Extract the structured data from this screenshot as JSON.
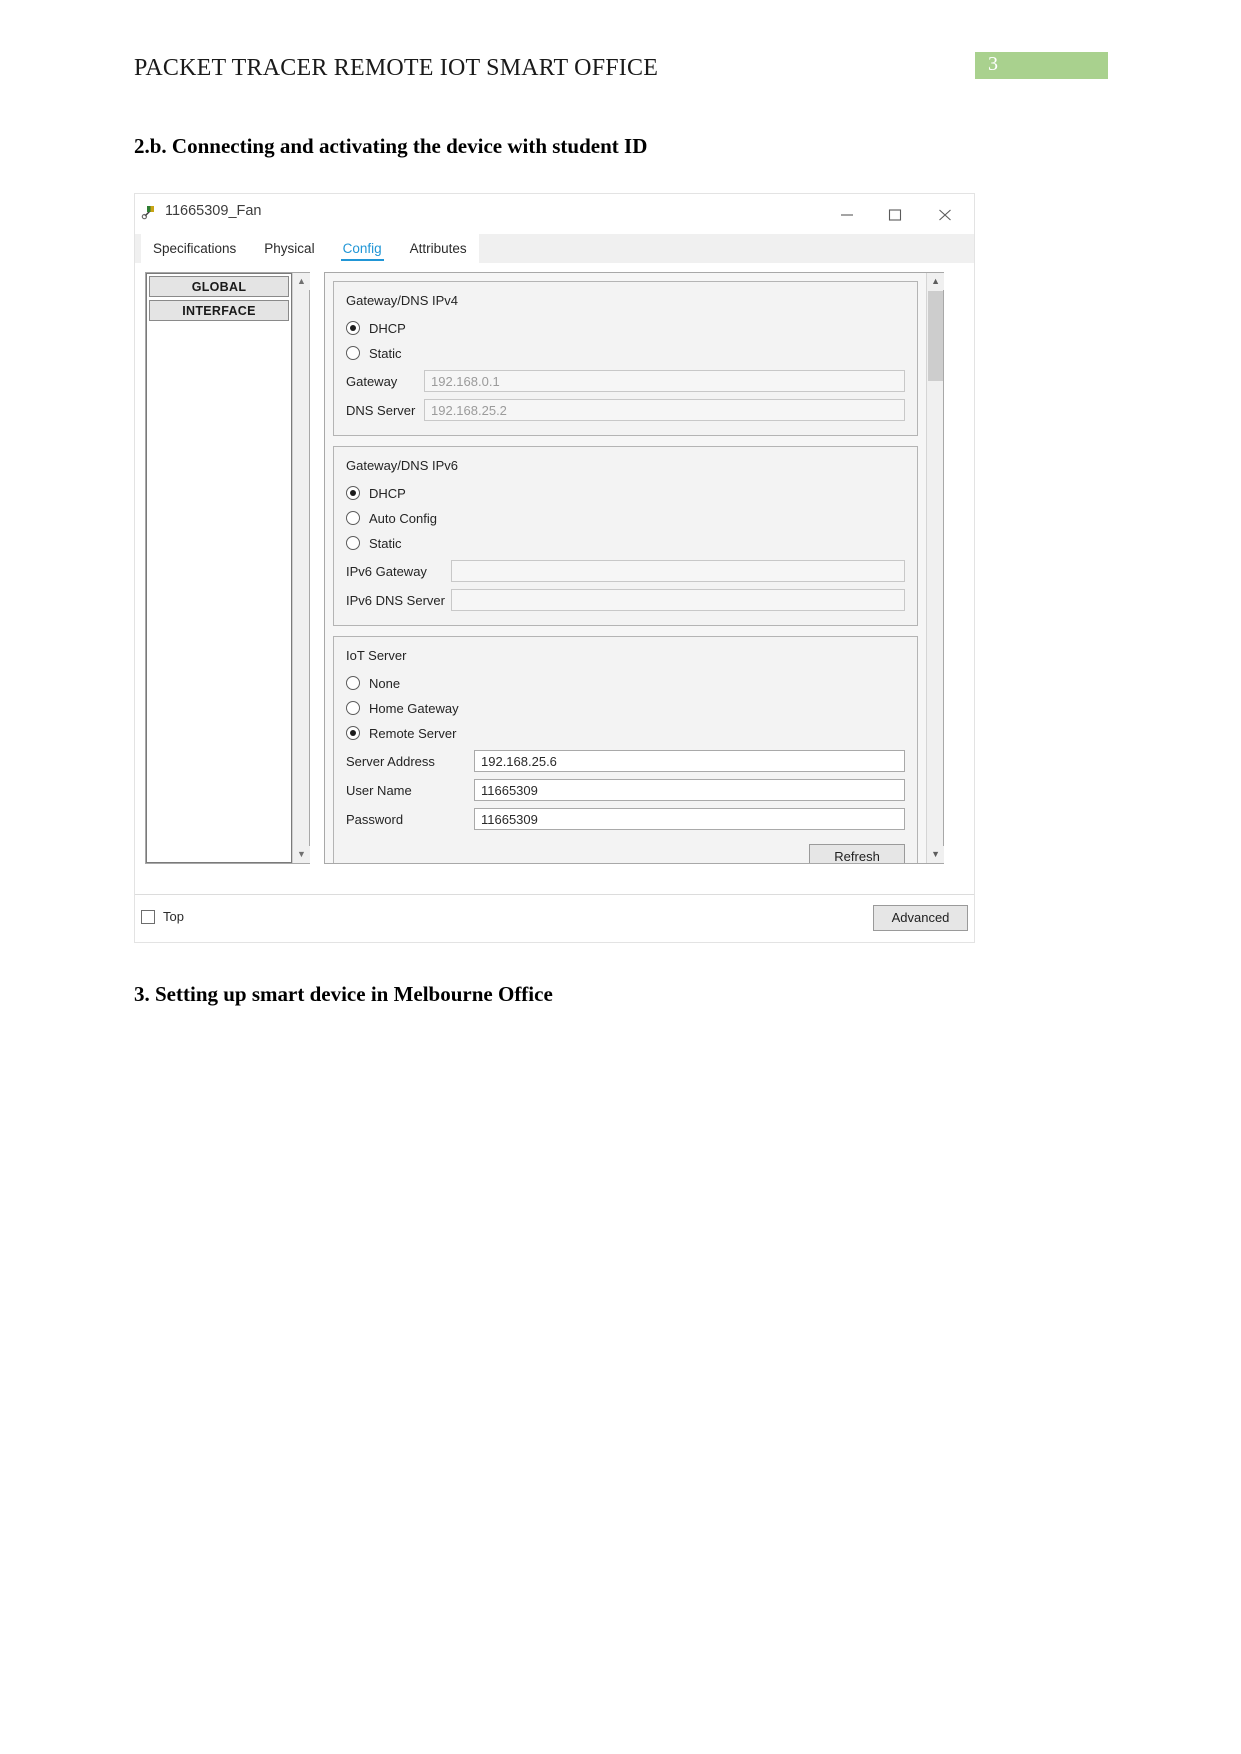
{
  "document": {
    "title": "PACKET TRACER REMOTE IOT SMART OFFICE",
    "page_number": "3",
    "page_badge_color": "#a9d18e",
    "heading_2b": "2.b. Connecting and activating the device with student ID",
    "heading_3": "3. Setting up smart device in Melbourne Office"
  },
  "window": {
    "title": "11665309_Fan",
    "icon": "packet-tracer-fan-icon",
    "controls": {
      "minimize": "minimize-icon",
      "maximize": "maximize-icon",
      "close": "close-icon"
    },
    "tabs": [
      {
        "label": "Specifications",
        "active": false
      },
      {
        "label": "Physical",
        "active": false
      },
      {
        "label": "Config",
        "active": true
      },
      {
        "label": "Attributes",
        "active": false
      }
    ],
    "active_tab_color": "#2196d6",
    "sidebar": {
      "items": [
        {
          "label": "GLOBAL"
        },
        {
          "label": "INTERFACE"
        }
      ],
      "scroll_up_icon": "chevron-up-icon",
      "scroll_down_icon": "chevron-down-icon"
    },
    "config": {
      "ipv4": {
        "group_title": "Gateway/DNS IPv4",
        "options": [
          {
            "label": "DHCP",
            "selected": true
          },
          {
            "label": "Static",
            "selected": false
          }
        ],
        "fields": [
          {
            "label": "Gateway",
            "value": "192.168.0.1",
            "disabled": true
          },
          {
            "label": "DNS Server",
            "value": "192.168.25.2",
            "disabled": true
          }
        ]
      },
      "ipv6": {
        "group_title": "Gateway/DNS IPv6",
        "options": [
          {
            "label": "DHCP",
            "selected": true
          },
          {
            "label": "Auto Config",
            "selected": false
          },
          {
            "label": "Static",
            "selected": false
          }
        ],
        "fields": [
          {
            "label": "IPv6 Gateway",
            "value": "",
            "disabled": true
          },
          {
            "label": "IPv6 DNS Server",
            "value": "",
            "disabled": true
          }
        ]
      },
      "iot": {
        "group_title": "IoT Server",
        "options": [
          {
            "label": "None",
            "selected": false
          },
          {
            "label": "Home Gateway",
            "selected": false
          },
          {
            "label": "Remote Server",
            "selected": true
          }
        ],
        "fields": [
          {
            "label": "Server Address",
            "value": "192.168.25.6",
            "disabled": false
          },
          {
            "label": "User Name",
            "value": "11665309",
            "disabled": false
          },
          {
            "label": "Password",
            "value": "11665309",
            "disabled": false
          }
        ],
        "refresh_label": "Refresh"
      },
      "scroll_up_icon": "chevron-up-icon",
      "scroll_down_icon": "chevron-down-icon"
    },
    "footer": {
      "top_checkbox_label": "Top",
      "top_checkbox_checked": false,
      "advanced_label": "Advanced"
    }
  }
}
